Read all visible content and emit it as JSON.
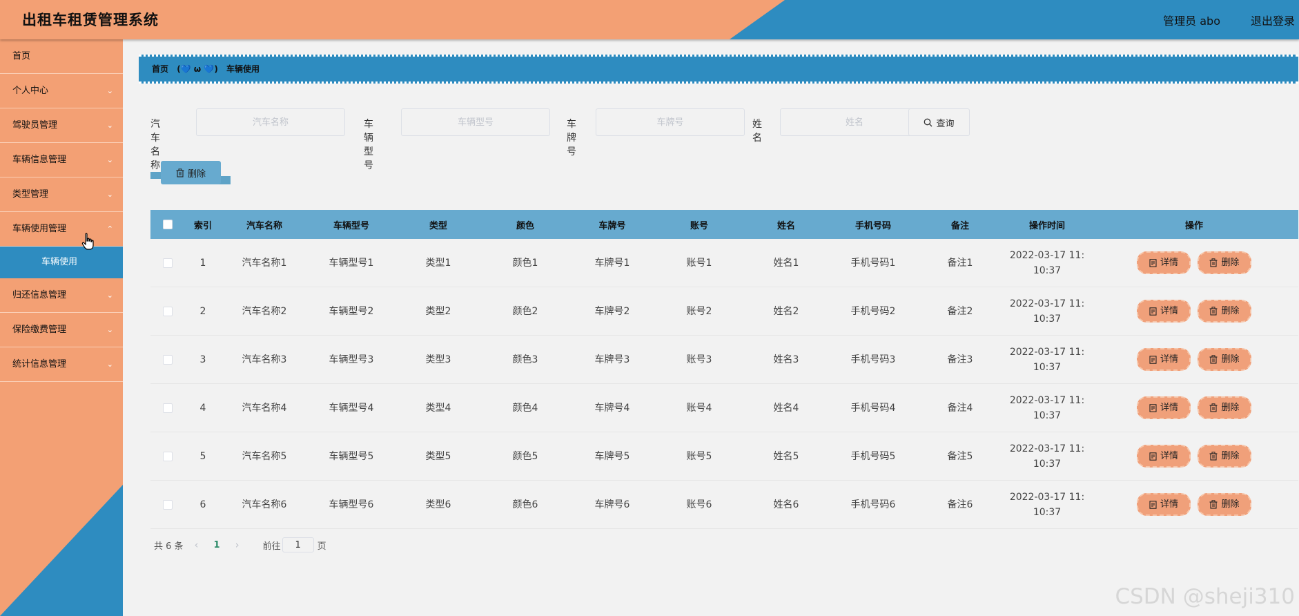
{
  "header": {
    "title": "出租车租赁管理系统",
    "user": "管理员 abo",
    "logout": "退出登录"
  },
  "sidebar": {
    "items": [
      {
        "label": "首页",
        "has_arrow": false
      },
      {
        "label": "个人中心",
        "has_arrow": true
      },
      {
        "label": "驾驶员管理",
        "has_arrow": true
      },
      {
        "label": "车辆信息管理",
        "has_arrow": true
      },
      {
        "label": "类型管理",
        "has_arrow": true
      },
      {
        "label": "车辆使用管理",
        "has_arrow": true
      }
    ],
    "active_sub": "车辆使用",
    "items_after": [
      {
        "label": "归还信息管理",
        "has_arrow": true
      },
      {
        "label": "保险缴费管理",
        "has_arrow": true
      },
      {
        "label": "统计信息管理",
        "has_arrow": true
      }
    ]
  },
  "breadcrumb": {
    "home": "首页",
    "emoji": "(💙 ω 💙)",
    "current": "车辆使用"
  },
  "search": {
    "fields": [
      {
        "label": "汽车名称",
        "placeholder": "汽车名称"
      },
      {
        "label": "车辆型号",
        "placeholder": "车辆型号"
      },
      {
        "label": "车牌号",
        "placeholder": "车牌号"
      },
      {
        "label": "姓名",
        "placeholder": "姓名"
      }
    ],
    "query_label": "查询"
  },
  "toolbar": {
    "delete_label": "删除"
  },
  "table": {
    "columns": [
      "索引",
      "汽车名称",
      "车辆型号",
      "类型",
      "颜色",
      "车牌号",
      "账号",
      "姓名",
      "手机号码",
      "备注",
      "操作时间",
      "操作"
    ],
    "rows": [
      [
        "1",
        "汽车名称1",
        "车辆型号1",
        "类型1",
        "颜色1",
        "车牌号1",
        "账号1",
        "姓名1",
        "手机号码1",
        "备注1",
        "2022-03-17 11:",
        "10:37"
      ],
      [
        "2",
        "汽车名称2",
        "车辆型号2",
        "类型2",
        "颜色2",
        "车牌号2",
        "账号2",
        "姓名2",
        "手机号码2",
        "备注2",
        "2022-03-17 11:",
        "10:37"
      ],
      [
        "3",
        "汽车名称3",
        "车辆型号3",
        "类型3",
        "颜色3",
        "车牌号3",
        "账号3",
        "姓名3",
        "手机号码3",
        "备注3",
        "2022-03-17 11:",
        "10:37"
      ],
      [
        "4",
        "汽车名称4",
        "车辆型号4",
        "类型4",
        "颜色4",
        "车牌号4",
        "账号4",
        "姓名4",
        "手机号码4",
        "备注4",
        "2022-03-17 11:",
        "10:37"
      ],
      [
        "5",
        "汽车名称5",
        "车辆型号5",
        "类型5",
        "颜色5",
        "车牌号5",
        "账号5",
        "姓名5",
        "手机号码5",
        "备注5",
        "2022-03-17 11:",
        "10:37"
      ],
      [
        "6",
        "汽车名称6",
        "车辆型号6",
        "类型6",
        "颜色6",
        "车牌号6",
        "账号6",
        "姓名6",
        "手机号码6",
        "备注6",
        "2022-03-17 11:",
        "10:37"
      ]
    ],
    "detail_label": "详情",
    "delete_label": "删除"
  },
  "pagination": {
    "total": "共 6 条",
    "current": "1",
    "goto_label": "前往",
    "goto_value": "1",
    "unit": "页"
  },
  "watermark": "CSDN @sheji310",
  "colors": {
    "orange": "#f3a074",
    "blue": "#2e8cc0",
    "table_header": "#67aacf"
  }
}
